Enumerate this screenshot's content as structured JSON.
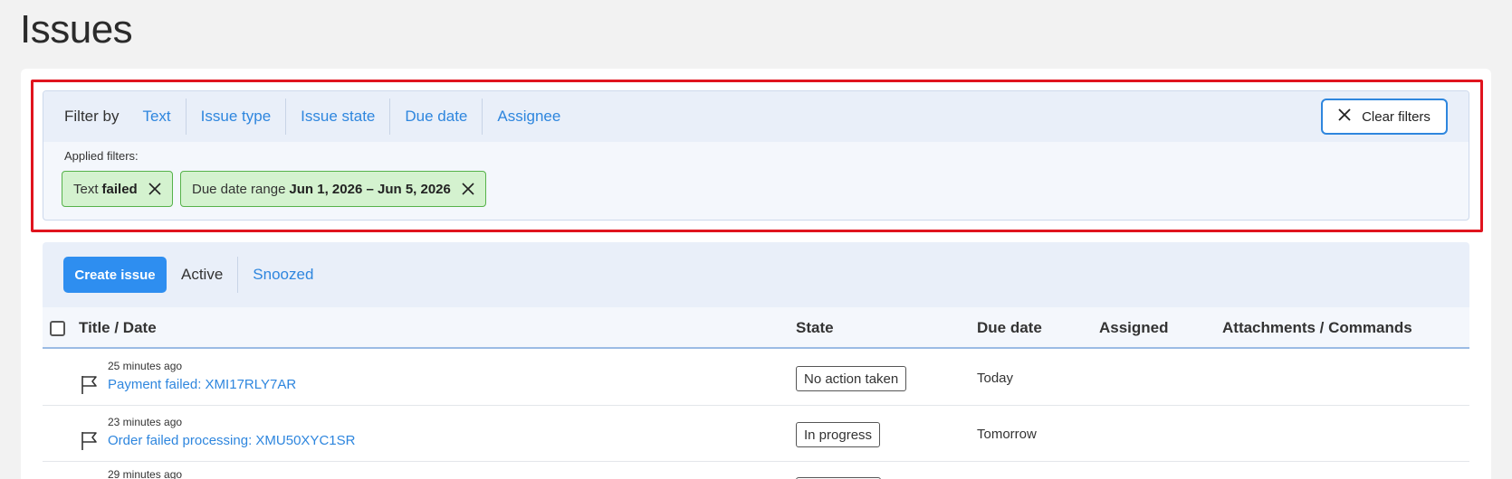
{
  "page": {
    "title": "Issues"
  },
  "filters": {
    "filter_by_label": "Filter by",
    "options": [
      "Text",
      "Issue type",
      "Issue state",
      "Due date",
      "Assignee"
    ],
    "clear_label": "Clear filters",
    "applied_label": "Applied filters:",
    "applied": [
      {
        "name": "Text",
        "value": "failed"
      },
      {
        "name": "Due date range",
        "value": "Jun 1, 2026 – Jun 5, 2026"
      }
    ]
  },
  "toolbar": {
    "create_label": "Create issue",
    "tabs": [
      {
        "label": "Active",
        "active": true
      },
      {
        "label": "Snoozed",
        "active": false
      }
    ]
  },
  "table": {
    "columns": [
      "Title / Date",
      "State",
      "Due date",
      "Assigned",
      "Attachments / Commands"
    ],
    "rows": [
      {
        "time": "25 minutes ago",
        "title": "Payment failed: XMI17RLY7AR",
        "state": "No action taken",
        "due": "Today",
        "assigned": ""
      },
      {
        "time": "23 minutes ago",
        "title": "Order failed processing: XMU50XYC1SR",
        "state": "In progress",
        "due": "Tomorrow",
        "assigned": ""
      },
      {
        "time": "29 minutes ago",
        "title": "",
        "state": "",
        "due": "",
        "assigned": ""
      }
    ]
  },
  "colors": {
    "accent": "#2e86de",
    "chip_bg": "#d4f2cf",
    "chip_border": "#56b24a",
    "highlight": "#e0141e"
  }
}
